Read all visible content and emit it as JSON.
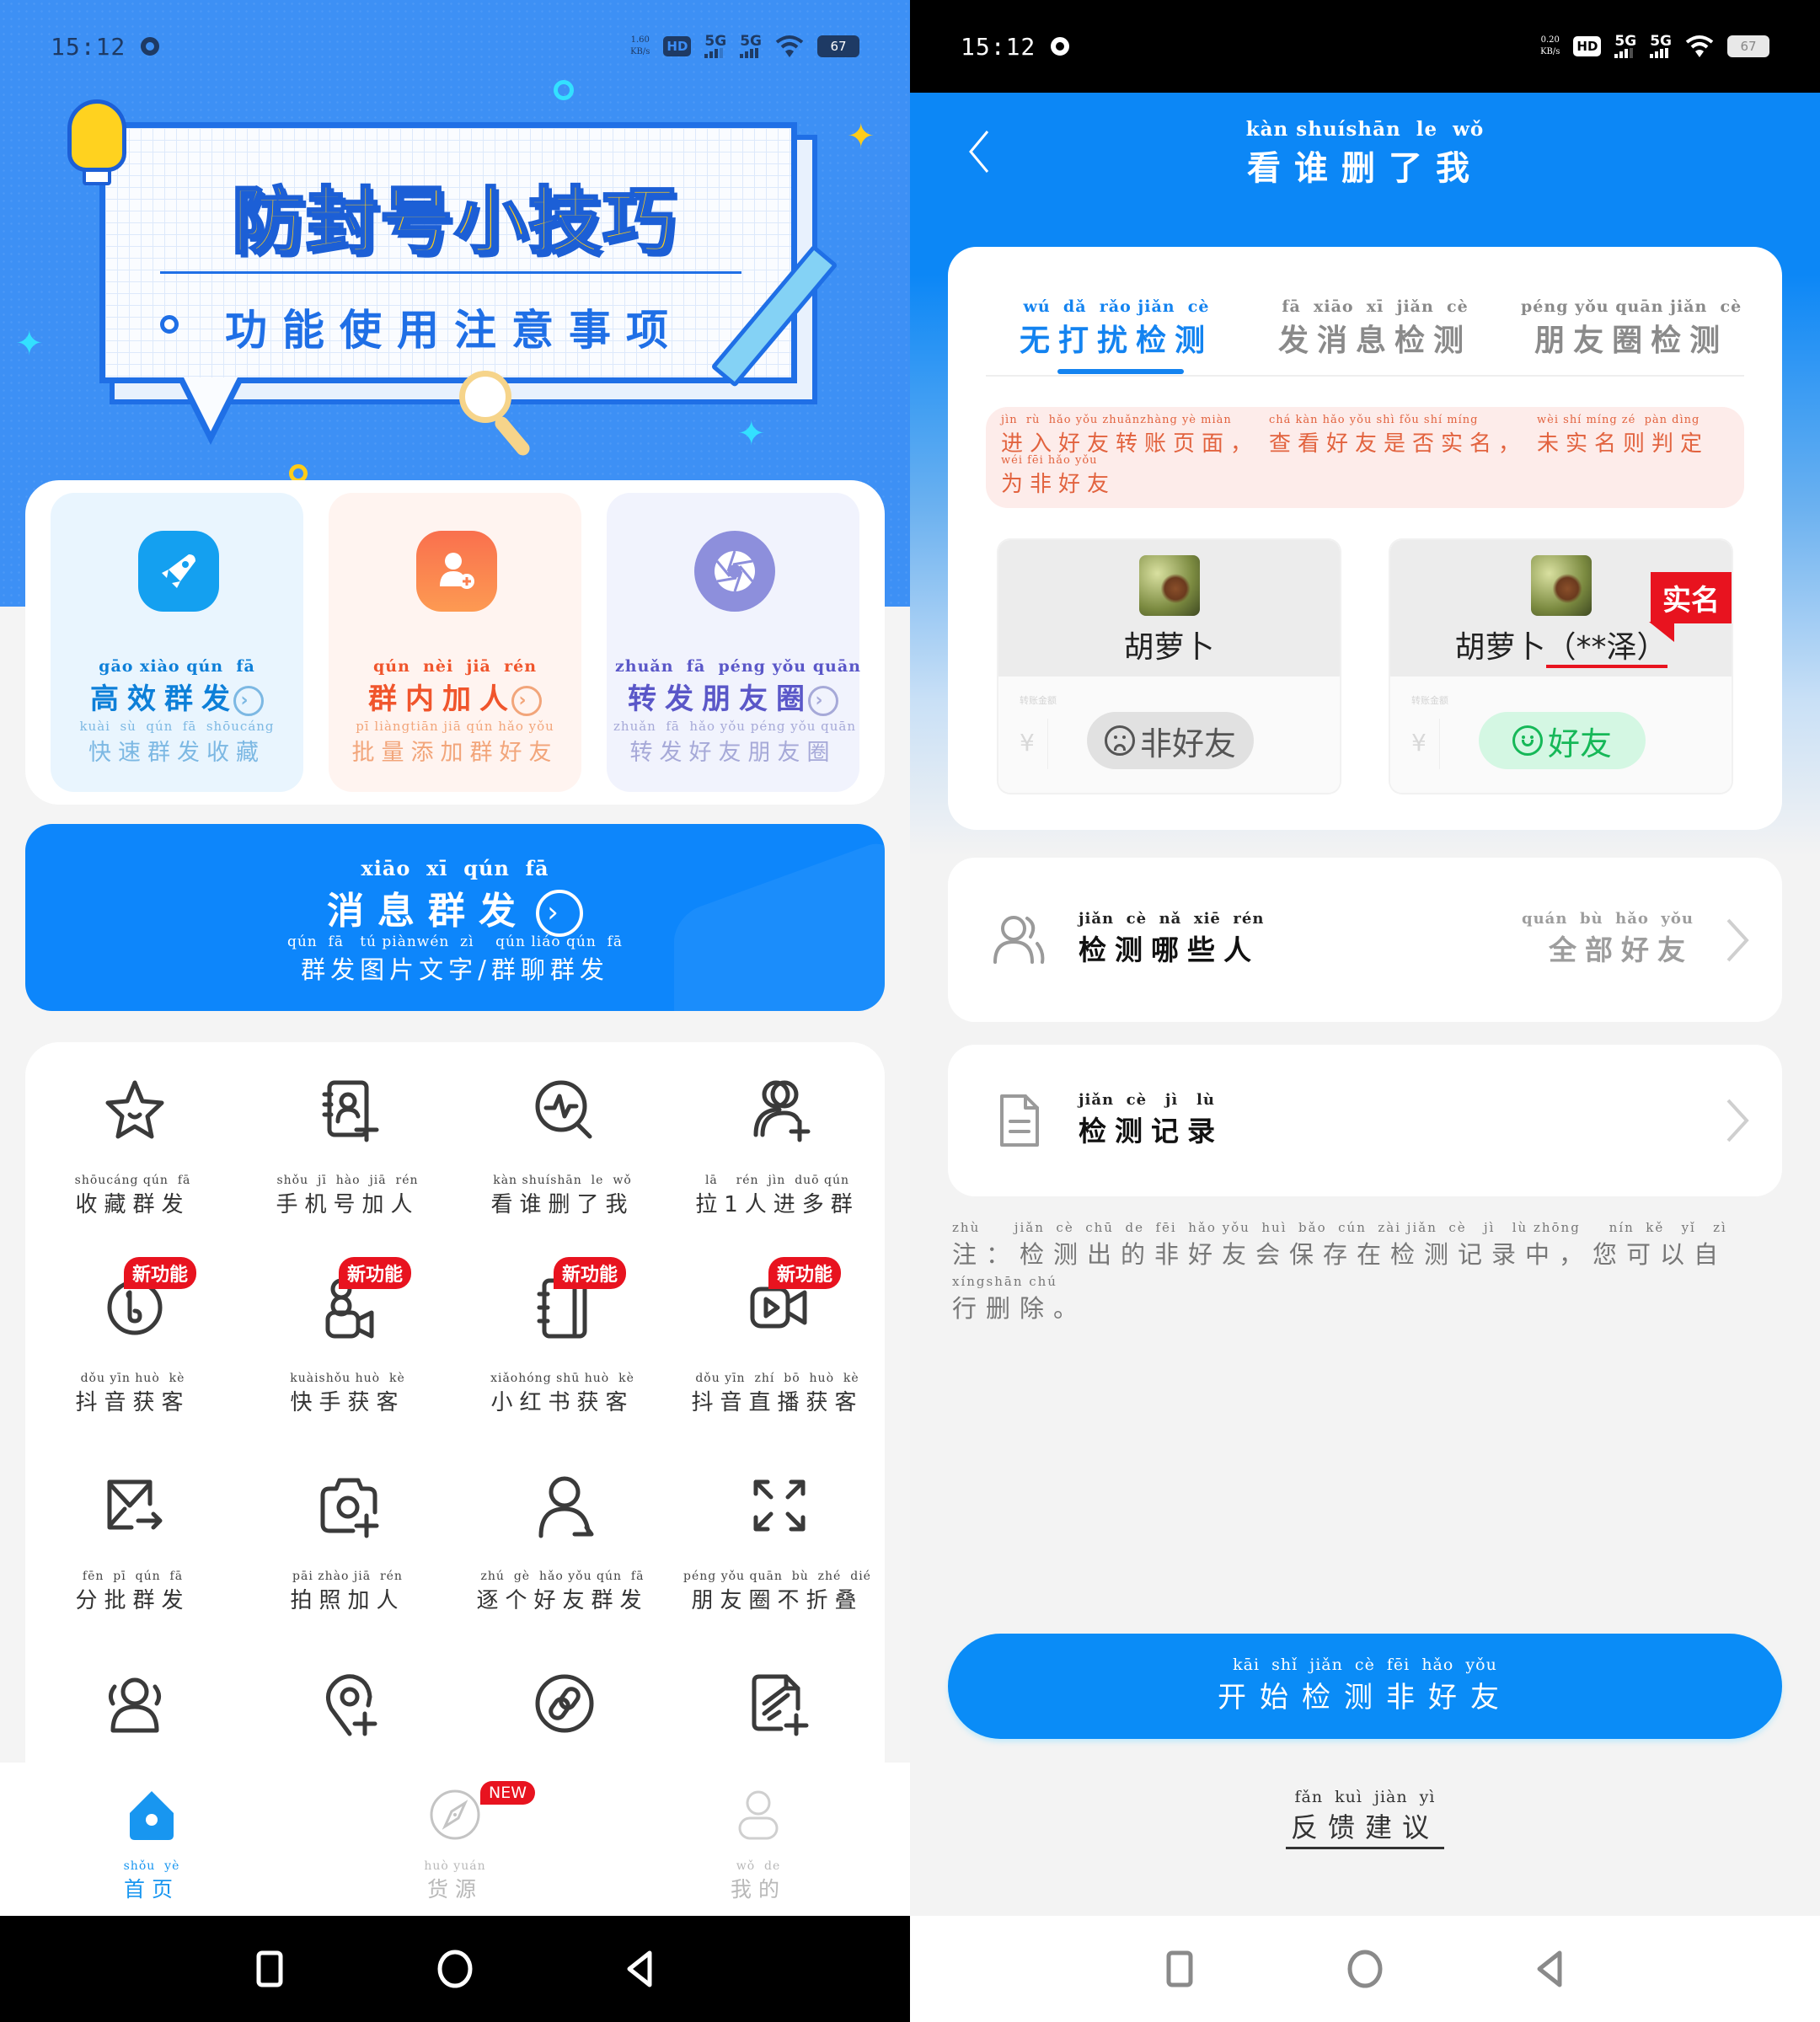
{
  "left": {
    "status_bar": {
      "time": "15:12",
      "net_speed_value": "1.60",
      "net_speed_unit": "KB/s",
      "hd": "HD",
      "sim1": "5G",
      "sim2": "5G",
      "battery": "67"
    },
    "hero": {
      "title": "防封号小技巧",
      "subtitle": "功能使用注意事项"
    },
    "features": [
      {
        "pinyin": "gāo xiào qún  fā",
        "label": "高效群发",
        "sub_pinyin": "kuài  sù  qún  fā  shōucáng",
        "sub_label": "快速群发收藏",
        "icon": "rocket-icon",
        "color": "#0d7fd8",
        "sub_color": "#7cb8e3",
        "bg": "#e9f5fe"
      },
      {
        "pinyin": "qún  nèi  jiā  rén",
        "label": "群内加人",
        "sub_pinyin": "pī liàngtiān jiā qún hǎo yǒu",
        "sub_label": "批量添加群好友",
        "icon": "add-user-icon",
        "color": "#f0552c",
        "sub_color": "#f2a57a",
        "bg": "#fff4f0"
      },
      {
        "pinyin": "zhuǎn  fā  péng yǒu quān",
        "label": "转发朋友圈",
        "sub_pinyin": "zhuǎn  fā  hǎo yǒu péng yǒu quān",
        "sub_label": "转发好友朋友圈",
        "icon": "aperture-icon",
        "color": "#5a57c8",
        "sub_color": "#a6a9d8",
        "bg": "#f1f3fd"
      }
    ],
    "mass_send": {
      "pinyin": "xiāo  xī  qún  fā",
      "label": "消息群发",
      "sub_pinyin": "qún  fā   tú piànwén  zì    qún liáo qún  fā",
      "sub_label": "群发图片文字/群聊群发"
    },
    "new_badge": "新功能",
    "grid": [
      {
        "pinyin": "shōucáng qún  fā",
        "label": "收藏群发",
        "icon": "star-icon",
        "is_new": false
      },
      {
        "pinyin": "shǒu  jī  hào  jiā  rén",
        "label": "手机号加人",
        "icon": "contact-book-add-icon",
        "is_new": false
      },
      {
        "pinyin": "kàn shuíshān  le  wǒ",
        "label": "看谁删了我",
        "icon": "pulse-search-icon",
        "is_new": false
      },
      {
        "pinyin": "lā    rén  jìn  duō qún",
        "label": "拉1人进多群",
        "icon": "users-add-icon",
        "is_new": false
      },
      {
        "pinyin": "dǒu yīn huò  kè",
        "label": "抖音获客",
        "icon": "douyin-icon",
        "is_new": true
      },
      {
        "pinyin": "kuàishǒu huò  kè",
        "label": "快手获客",
        "icon": "kuaishou-camera-icon",
        "is_new": true
      },
      {
        "pinyin": "xiǎohóng shū huò  kè",
        "label": "小红书获客",
        "icon": "notebook-icon",
        "is_new": true
      },
      {
        "pinyin": "dǒu yīn  zhí  bō  huò  kè",
        "label": "抖音直播获客",
        "icon": "video-camera-icon",
        "is_new": true
      },
      {
        "pinyin": "fēn  pī  qún  fā",
        "label": "分批群发",
        "icon": "mail-forward-icon",
        "is_new": false
      },
      {
        "pinyin": "pāi zhào jiā  rén",
        "label": "拍照加人",
        "icon": "camera-add-icon",
        "is_new": false
      },
      {
        "pinyin": "zhú  gè  hǎo yǒu qún  fā",
        "label": "逐个好友群发",
        "icon": "user-send-icon",
        "is_new": false
      },
      {
        "pinyin": "péng yǒu quān  bù  zhé  dié",
        "label": "朋友圈不折叠",
        "icon": "expand-icon",
        "is_new": false
      },
      {
        "pinyin": "",
        "label": "",
        "icon": "group-icon",
        "is_new": false
      },
      {
        "pinyin": "",
        "label": "",
        "icon": "location-add-icon",
        "is_new": false
      },
      {
        "pinyin": "",
        "label": "",
        "icon": "link-icon",
        "is_new": false
      },
      {
        "pinyin": "",
        "label": "",
        "icon": "document-edit-add-icon",
        "is_new": false
      }
    ],
    "tabs": [
      {
        "pinyin": "shǒu  yè",
        "label": "首页",
        "icon": "home-icon",
        "active": true
      },
      {
        "pinyin": "huò yuán",
        "label": "货源",
        "icon": "compass-icon",
        "active": false,
        "badge": "NEW"
      },
      {
        "pinyin": "wǒ  de",
        "label": "我的",
        "icon": "profile-icon",
        "active": false
      }
    ],
    "colors": {
      "brand_blue": "#0d86fb",
      "tab_active": "#1896f0",
      "tab_inactive": "#b9b9b9",
      "badge_red": "#e8131f"
    }
  },
  "right": {
    "status_bar": {
      "time": "15:12",
      "net_speed_value": "0.20",
      "net_speed_unit": "KB/s",
      "hd": "HD",
      "sim1": "5G",
      "sim2": "5G",
      "battery": "67"
    },
    "header": {
      "pinyin": "kàn shuíshān  le  wǒ",
      "title": "看谁删了我"
    },
    "detect_tabs": [
      {
        "pinyin": "wú  dǎ  rǎo jiǎn  cè",
        "label": "无打扰检测",
        "active": true
      },
      {
        "pinyin": "fā  xiāo  xī  jiǎn  cè",
        "label": "发消息检测",
        "active": false
      },
      {
        "pinyin": "péng yǒu quān jiǎn  cè",
        "label": "朋友圈检测",
        "active": false
      }
    ],
    "tip": [
      {
        "pinyin": "jìn  rù  hǎo yǒu zhuǎnzhàng yè miàn",
        "text": "进入好友转账页面，"
      },
      {
        "pinyin": "chá kàn hǎo yǒu shì fǒu shí míng",
        "text": "查看好友是否实名，"
      },
      {
        "pinyin": "wèi shí míng zé  pàn dìng",
        "text": "未实名则判定"
      },
      {
        "pinyin": "wéi fēi hǎo yǒu",
        "text": "为非好友"
      }
    ],
    "examples": [
      {
        "name": "胡萝卜",
        "real_name": "",
        "amount_label": "转账金额",
        "currency": "¥",
        "status": "非好友",
        "is_friend": false
      },
      {
        "name": "胡萝卜",
        "real_name": "（**泽）",
        "amount_label": "转账金额",
        "currency": "¥",
        "status": "好友",
        "is_friend": true,
        "badge": "实名"
      }
    ],
    "options": [
      {
        "pinyin": "jiǎn  cè  nǎ  xiē  rén",
        "label": "检测哪些人",
        "value_pinyin": "quán  bù  hǎo  yǒu",
        "value": "全部好友",
        "icon": "people-icon"
      },
      {
        "pinyin": "jiǎn  cè   jì   lù",
        "label": "检测记录",
        "value_pinyin": "",
        "value": "",
        "icon": "document-icon"
      }
    ],
    "note": {
      "line1_pinyin": "zhù      jiǎn  cè  chū  de  fēi  hǎo yǒu  huì  bǎo  cún  zài jiǎn  cè   jì   lù zhōng     nín  kě   yǐ   zì",
      "line1": "注：检测出的非好友会保存在检测记录中，您可以自",
      "line2_pinyin": "xíngshān chú",
      "line2": "行删除。"
    },
    "start_button": {
      "pinyin": "kāi  shǐ  jiǎn  cè  fēi  hǎo  yǒu",
      "label": "开始检测非好友"
    },
    "feedback": {
      "pinyin": "fǎn  kuì  jiàn  yì",
      "label": "反馈建议"
    },
    "colors": {
      "header_blue": "#0c87f6",
      "tab_active": "#1383f0",
      "tip_text": "#e2633f",
      "tip_bg": "#fdecea",
      "friend_green": "#16b858",
      "non_friend_gray": "#555555"
    }
  }
}
